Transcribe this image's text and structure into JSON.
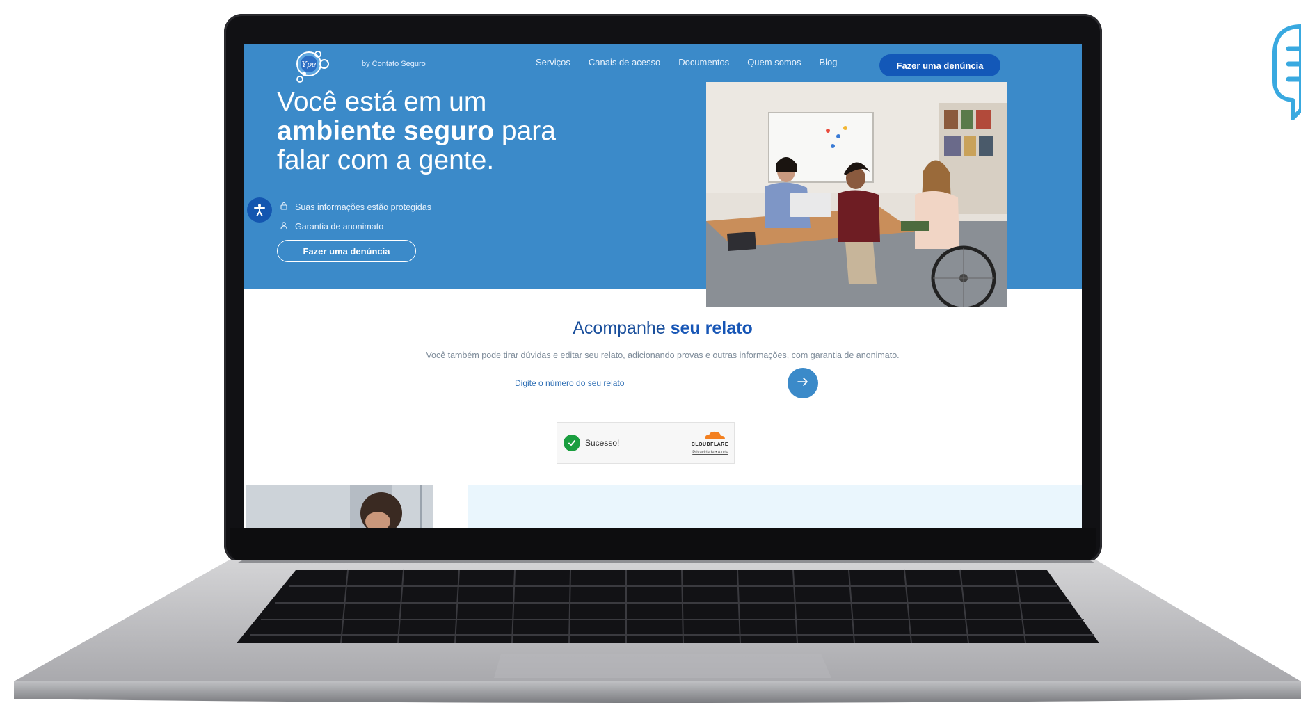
{
  "header": {
    "logo_text": "Ype",
    "tagline": "by Contato Seguro",
    "nav": [
      {
        "label": "Serviços"
      },
      {
        "label": "Canais de acesso"
      },
      {
        "label": "Documentos"
      },
      {
        "label": "Quem somos"
      },
      {
        "label": "Blog"
      }
    ],
    "cta_label": "Fazer uma denúncia"
  },
  "hero": {
    "line1": "Você está em um",
    "line2_bold": "ambiente seguro",
    "line2_rest": " para",
    "line3": "falar com a gente.",
    "features": [
      {
        "icon": "lock-icon",
        "text": "Suas informações estão protegidas"
      },
      {
        "icon": "user-icon",
        "text": "Garantia de anonimato"
      }
    ],
    "cta_label": "Fazer uma denúncia"
  },
  "tracking": {
    "title_plain": "Acompanhe ",
    "title_bold": "seu relato",
    "subtitle": "Você também pode tirar dúvidas e editar seu relato, adicionando provas e outras informações, com garantia de anonimato.",
    "input_placeholder": "Digite o número do seu relato",
    "submit_icon": "arrow-right-icon",
    "captcha": {
      "status": "Sucesso!",
      "brand": "CLOUDFLARE",
      "links": "Privacidade • Ajuda"
    }
  },
  "colors": {
    "hero_blue": "#3b8ac9",
    "dark_blue": "#1358b8",
    "success_green": "#1a9e3f",
    "cloudflare_orange": "#f38020",
    "light_panel": "#eaf6fd"
  }
}
